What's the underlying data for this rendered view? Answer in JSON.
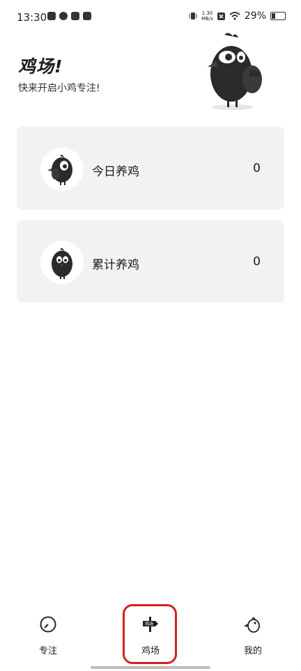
{
  "status": {
    "time": "13:30",
    "network_speed": "1.30\nMB/s",
    "battery": "29%"
  },
  "header": {
    "title": "鸡场!",
    "subtitle": "快来开启小鸡专注!"
  },
  "cards": {
    "today": {
      "label": "今日养鸡",
      "value": "0"
    },
    "total": {
      "label": "累计养鸡",
      "value": "0"
    }
  },
  "tabs": {
    "focus": "专注",
    "farm": "鸡场",
    "farm_sign": "鸡场",
    "mine": "我的"
  },
  "colors": {
    "highlight": "#d42020",
    "card_bg": "#f2f2f2",
    "chick": "#2b2b2b"
  }
}
